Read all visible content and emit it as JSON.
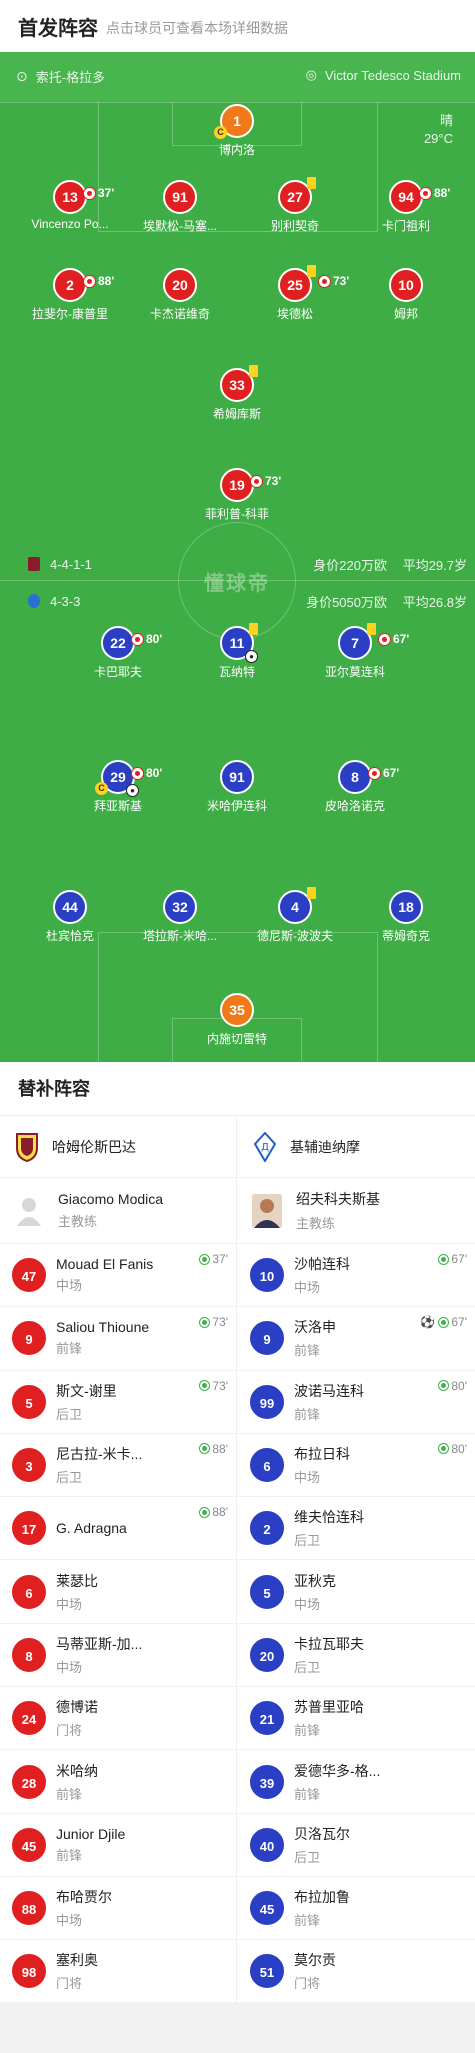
{
  "header": {
    "title": "首发阵容",
    "hint": "点击球员可查看本场详细数据"
  },
  "pitch": {
    "home_team_name": "索托-格拉多",
    "stadium": "Victor Tedesco Stadium",
    "weather": "晴",
    "temperature": "29°C",
    "home_formation": "4-4-1-1",
    "home_value": "身价220万欧",
    "home_age": "平均29.7岁",
    "away_formation": "4-3-3",
    "away_value": "身价5050万欧",
    "away_age": "平均26.8岁",
    "watermark": "懂球帝",
    "colors": {
      "home": "#e02020",
      "away": "#2a3fc4",
      "goalkeeper": "#f07a1a",
      "pitch": "#3fad45"
    }
  },
  "home_players": [
    {
      "number": "1",
      "name": "博内洛",
      "gk": true,
      "captain": true
    },
    {
      "number": "13",
      "name": "Vincenzo Po...",
      "sub_min": "37'"
    },
    {
      "number": "91",
      "name": "埃默松-马塞..."
    },
    {
      "number": "27",
      "name": "别利契奇",
      "yellow": true
    },
    {
      "number": "94",
      "name": "卡门祖利",
      "sub_min": "88'"
    },
    {
      "number": "2",
      "name": "拉斐尔-康普里",
      "sub_min": "88'"
    },
    {
      "number": "20",
      "name": "卡杰诺维奇"
    },
    {
      "number": "25",
      "name": "埃德松",
      "yellow": true,
      "sub_min": "73'"
    },
    {
      "number": "10",
      "name": "姆邦"
    },
    {
      "number": "33",
      "name": "希姆库斯",
      "yellow": true
    },
    {
      "number": "19",
      "name": "菲利普-科菲",
      "sub_min": "73'"
    }
  ],
  "away_players": [
    {
      "number": "22",
      "name": "卡巴耶夫",
      "sub_min": "80'"
    },
    {
      "number": "11",
      "name": "瓦纳特",
      "yellow": true,
      "goal": true
    },
    {
      "number": "7",
      "name": "亚尔莫连科",
      "yellow": true,
      "sub_min": "67'"
    },
    {
      "number": "29",
      "name": "拜亚斯基",
      "sub_min": "80'",
      "captain": true,
      "goal": true
    },
    {
      "number": "91",
      "name": "米哈伊连科"
    },
    {
      "number": "8",
      "name": "皮哈洛诺克",
      "sub_min": "67'"
    },
    {
      "number": "44",
      "name": "杜宾恰克"
    },
    {
      "number": "32",
      "name": "塔拉斯-米哈..."
    },
    {
      "number": "4",
      "name": "德尼斯-波波夫",
      "yellow": true
    },
    {
      "number": "18",
      "name": "蒂姆奇克"
    },
    {
      "number": "35",
      "name": "内施切雷特",
      "gk": true
    }
  ],
  "subs": {
    "title": "替补阵容",
    "home": {
      "team": "哈姆伦斯巴达",
      "coach": "Giacomo Modica",
      "coach_role": "主教练",
      "players": [
        {
          "number": "47",
          "name": "Mouad El Fanis",
          "pos": "中场",
          "event": "37'"
        },
        {
          "number": "9",
          "name": "Saliou Thioune",
          "pos": "前锋",
          "event": "73'"
        },
        {
          "number": "5",
          "name": "斯文-谢里",
          "pos": "后卫",
          "event": "73'"
        },
        {
          "number": "3",
          "name": "尼古拉-米卡...",
          "pos": "后卫",
          "event": "88'"
        },
        {
          "number": "17",
          "name": "G. Adragna",
          "pos": "",
          "event": "88'"
        },
        {
          "number": "6",
          "name": "莱瑟比",
          "pos": "中场"
        },
        {
          "number": "8",
          "name": "马蒂亚斯-加...",
          "pos": "中场"
        },
        {
          "number": "24",
          "name": "德博诺",
          "pos": "门将"
        },
        {
          "number": "28",
          "name": "米哈纳",
          "pos": "前锋"
        },
        {
          "number": "45",
          "name": "Junior Djile",
          "pos": "前锋"
        },
        {
          "number": "88",
          "name": "布哈贾尔",
          "pos": "中场"
        },
        {
          "number": "98",
          "name": "塞利奥",
          "pos": "门将"
        }
      ]
    },
    "away": {
      "team": "基辅迪纳摩",
      "coach": "绍夫科夫斯基",
      "coach_role": "主教练",
      "players": [
        {
          "number": "10",
          "name": "沙帕连科",
          "pos": "中场",
          "event": "67'"
        },
        {
          "number": "9",
          "name": "沃洛申",
          "pos": "前锋",
          "event": "67'",
          "goal": true
        },
        {
          "number": "99",
          "name": "波诺马连科",
          "pos": "前锋",
          "event": "80'"
        },
        {
          "number": "6",
          "name": "布拉日科",
          "pos": "中场",
          "event": "80'"
        },
        {
          "number": "2",
          "name": "维夫恰连科",
          "pos": "后卫"
        },
        {
          "number": "5",
          "name": "亚秋克",
          "pos": "中场"
        },
        {
          "number": "20",
          "name": "卡拉瓦耶夫",
          "pos": "后卫"
        },
        {
          "number": "21",
          "name": "苏普里亚哈",
          "pos": "前锋"
        },
        {
          "number": "39",
          "name": "爱德华多-格...",
          "pos": "前锋"
        },
        {
          "number": "40",
          "name": "贝洛瓦尔",
          "pos": "后卫"
        },
        {
          "number": "45",
          "name": "布拉加鲁",
          "pos": "前锋"
        },
        {
          "number": "51",
          "name": "莫尔贡",
          "pos": "门将"
        }
      ]
    }
  }
}
